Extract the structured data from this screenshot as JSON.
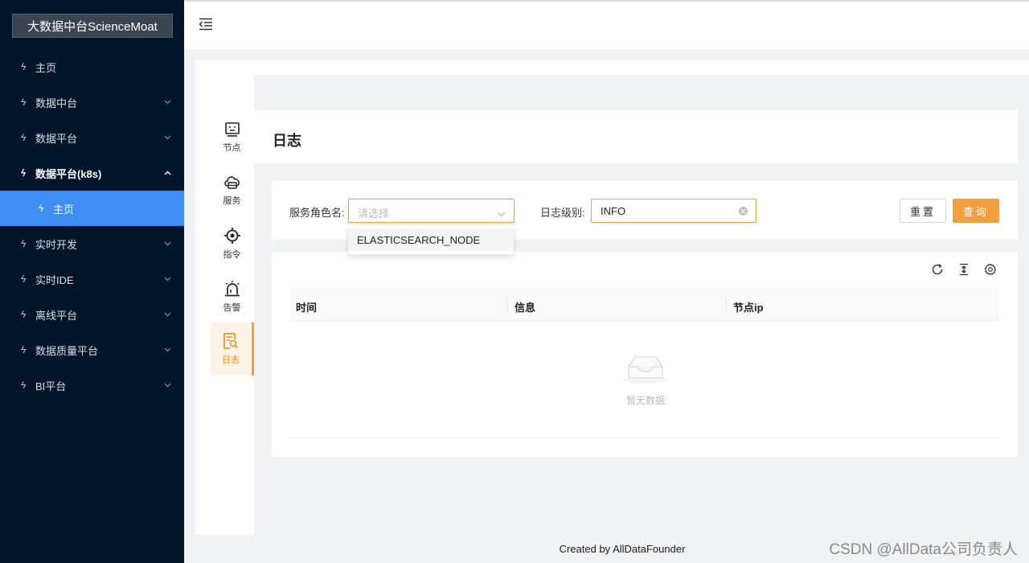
{
  "sidebar": {
    "brand": "大数据中台ScienceMoat",
    "items": [
      {
        "label": "主页"
      },
      {
        "label": "数据中台"
      },
      {
        "label": "数据平台"
      },
      {
        "label": "数据平台(k8s)"
      },
      {
        "label": "主页"
      },
      {
        "label": "实时开发"
      },
      {
        "label": "实时IDE"
      },
      {
        "label": "离线平台"
      },
      {
        "label": "数据质量平台"
      },
      {
        "label": "BI平台"
      }
    ]
  },
  "tabs": [
    {
      "label": "节点",
      "icon": "node-icon"
    },
    {
      "label": "服务",
      "icon": "service-icon"
    },
    {
      "label": "指令",
      "icon": "command-icon"
    },
    {
      "label": "告警",
      "icon": "alarm-icon"
    },
    {
      "label": "日志",
      "icon": "log-icon"
    }
  ],
  "page": {
    "title": "日志"
  },
  "filters": {
    "role_label": "服务角色名:",
    "role_placeholder": "请选择",
    "level_label": "日志级别:",
    "level_value": "INFO",
    "reset": "重置",
    "query": "查询"
  },
  "dropdown": {
    "options": [
      "ELASTICSEARCH_NODE"
    ]
  },
  "table": {
    "columns": [
      "时间",
      "信息",
      "节点ip"
    ],
    "empty_text": "暂无数据"
  },
  "footer": "Created by AllDataFounder",
  "watermark": "CSDN @AllData公司负责人",
  "colors": {
    "accent": "#f0a040",
    "sidebar": "#001529",
    "menu_active": "#3f8ef4"
  }
}
